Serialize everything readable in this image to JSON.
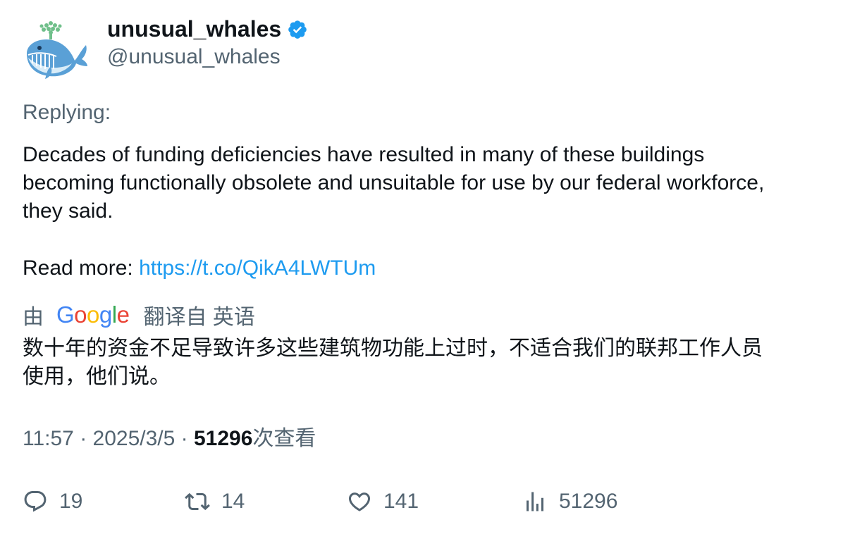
{
  "author": {
    "name": "unusual_whales",
    "handle": "@unusual_whales",
    "verified": true,
    "avatar_icon": "whale-logo-icon",
    "verified_color": "#1d9bf0"
  },
  "tweet": {
    "replying_label": "Replying:",
    "text_lines": [
      "Decades of funding deficiencies have resulted in many of these buildings",
      "becoming functionally obsolete and unsuitable for use by our federal workforce,",
      "they said."
    ],
    "readmore_label": "Read more: ",
    "link_text": "https://t.co/QikA4LWTUm"
  },
  "translation": {
    "prefix": "由",
    "provider_letters": [
      "G",
      "o",
      "o",
      "g",
      "l",
      "e"
    ],
    "suffix": "翻译自 英语",
    "lines": [
      "数十年的资金不足导致许多这些建筑物功能上过时，不适合我们的联邦工作人员",
      "使用，他们说。"
    ]
  },
  "meta": {
    "time": "11:57",
    "separator": " · ",
    "date": "2025/3/5",
    "views_count": "51296",
    "views_label": "次查看"
  },
  "actions": {
    "reply_count": "19",
    "retweet_count": "14",
    "like_count": "141",
    "views_count": "51296"
  },
  "colors": {
    "link": "#1d9bf0",
    "secondary_text": "#536471",
    "primary_text": "#0f1419"
  }
}
